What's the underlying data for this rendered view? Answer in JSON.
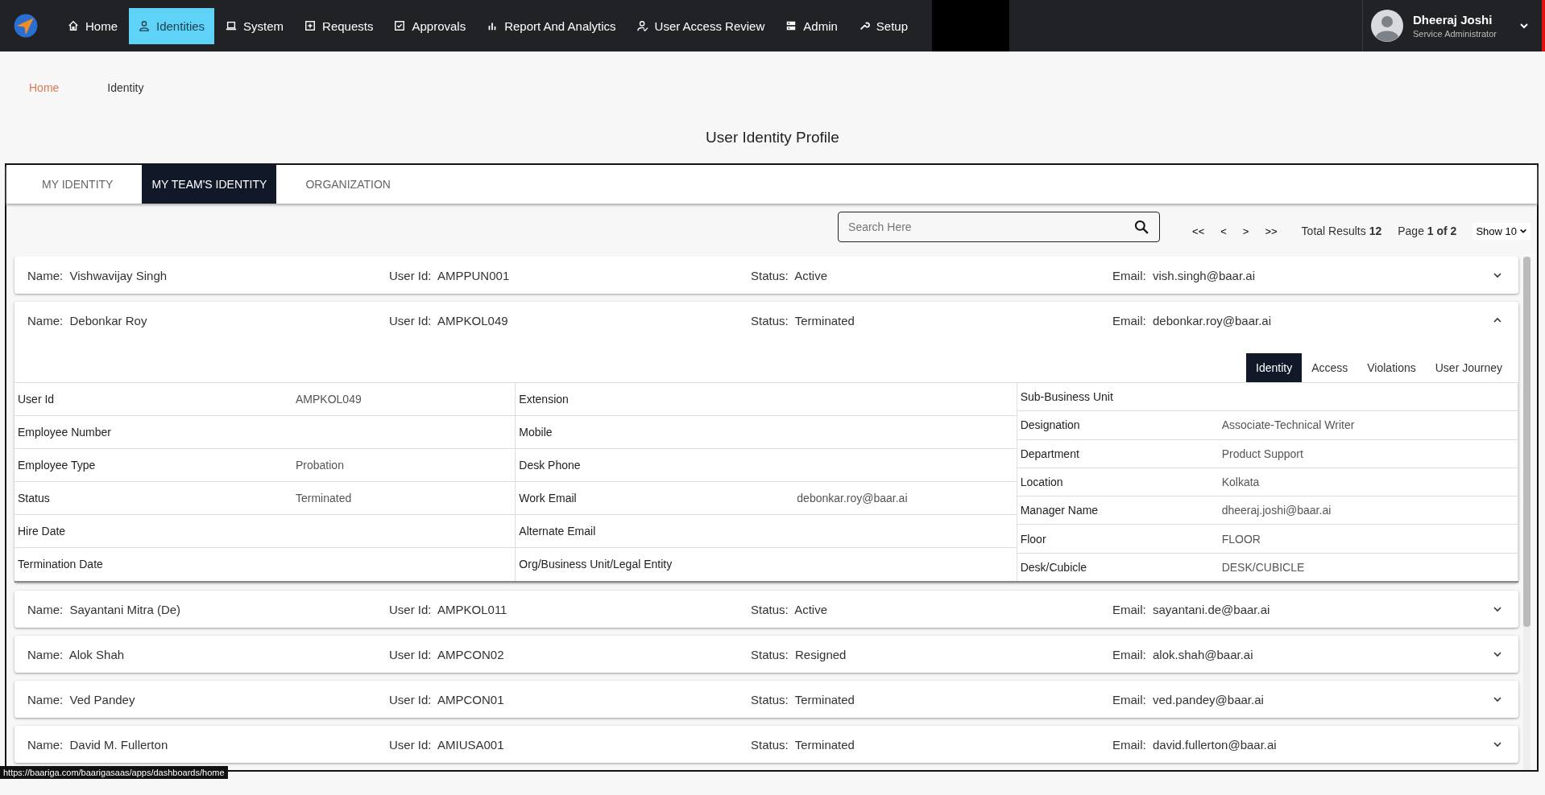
{
  "nav": {
    "items": [
      {
        "label": "Home",
        "kind": "home",
        "selected": false
      },
      {
        "label": "Identities",
        "kind": "person",
        "selected": true
      },
      {
        "label": "System",
        "kind": "laptop",
        "selected": false
      },
      {
        "label": "Requests",
        "kind": "plus-square",
        "selected": false
      },
      {
        "label": "Approvals",
        "kind": "check-square",
        "selected": false
      },
      {
        "label": "Report And Analytics",
        "kind": "bar-chart",
        "selected": false
      },
      {
        "label": "User Access Review",
        "kind": "user-check",
        "selected": false
      },
      {
        "label": "Admin",
        "kind": "server",
        "selected": false
      },
      {
        "label": "Setup",
        "kind": "wrench",
        "selected": false
      }
    ],
    "user": {
      "name": "Dheeraj Joshi",
      "role": "Service Administrator"
    }
  },
  "breadcrumb": [
    {
      "label": "Home",
      "kind": "link"
    },
    {
      "label": "Identity",
      "kind": "current"
    }
  ],
  "page_title": "User Identity Profile",
  "tabs": [
    {
      "label": "MY IDENTITY",
      "selected": false
    },
    {
      "label": "MY TEAM'S IDENTITY",
      "selected": true
    },
    {
      "label": "ORGANIZATION",
      "selected": false
    }
  ],
  "search": {
    "placeholder": "Search Here"
  },
  "pagination": {
    "first": "<<",
    "prev": "<",
    "next": ">",
    "last": ">>",
    "total_label": "Total Results",
    "total": "12",
    "page_label": "Page",
    "page": "1 of 2",
    "show": "Show 10"
  },
  "identities": [
    {
      "name_label": "Name:",
      "name": "Vishwavijay Singh",
      "user_id_label": "User Id:",
      "user_id": "AMPPUN001",
      "status_label": "Status:",
      "status": "Active",
      "email_label": "Email:",
      "email": "vish.singh@baar.ai",
      "expanded": false
    },
    {
      "name_label": "Name:",
      "name": "Debonkar Roy",
      "user_id_label": "User Id:",
      "user_id": "AMPKOL049",
      "status_label": "Status:",
      "status": "Terminated",
      "email_label": "Email:",
      "email": "debonkar.roy@baar.ai",
      "expanded": true,
      "detail": {
        "tabs": [
          {
            "label": "Identity",
            "selected": true
          },
          {
            "label": "Access",
            "selected": false
          },
          {
            "label": "Violations",
            "selected": false
          },
          {
            "label": "User Journey",
            "selected": false
          }
        ],
        "columns": [
          [
            {
              "label": "User Id",
              "value": "AMPKOL049"
            },
            {
              "label": "Employee Number"
            },
            {
              "label": "Employee Type",
              "value": "Probation"
            },
            {
              "label": "Status",
              "value": "Terminated"
            },
            {
              "label": "Hire Date"
            },
            {
              "label": "Termination Date"
            }
          ],
          [
            {
              "label": "Extension"
            },
            {
              "label": "Mobile"
            },
            {
              "label": "Desk Phone"
            },
            {
              "label": "Work Email",
              "value": "debonkar.roy@baar.ai"
            },
            {
              "label": "Alternate Email"
            },
            {
              "label": "Org/Business Unit/Legal Entity"
            }
          ],
          [
            {
              "label": "Sub-Business Unit"
            },
            {
              "label": "Designation",
              "value": "Associate-Technical Writer"
            },
            {
              "label": "Department",
              "value": "Product Support"
            },
            {
              "label": "Location",
              "value": "Kolkata"
            },
            {
              "label": "Manager Name",
              "value": "dheeraj.joshi@baar.ai"
            },
            {
              "label": "Floor",
              "value": "FLOOR"
            },
            {
              "label": "Desk/Cubicle",
              "value": "DESK/CUBICLE"
            }
          ]
        ]
      }
    },
    {
      "name_label": "Name:",
      "name": "Sayantani Mitra (De)",
      "user_id_label": "User Id:",
      "user_id": "AMPKOL011",
      "status_label": "Status:",
      "status": "Active",
      "email_label": "Email:",
      "email": "sayantani.de@baar.ai",
      "expanded": false
    },
    {
      "name_label": "Name:",
      "name": "Alok Shah",
      "user_id_label": "User Id:",
      "user_id": "AMPCON02",
      "status_label": "Status:",
      "status": "Resigned",
      "email_label": "Email:",
      "email": "alok.shah@baar.ai",
      "expanded": false
    },
    {
      "name_label": "Name:",
      "name": "Ved Pandey",
      "user_id_label": "User Id:",
      "user_id": "AMPCON01",
      "status_label": "Status:",
      "status": "Terminated",
      "email_label": "Email:",
      "email": "ved.pandey@baar.ai",
      "expanded": false
    },
    {
      "name_label": "Name:",
      "name": "David M. Fullerton",
      "user_id_label": "User Id:",
      "user_id": "AMIUSA001",
      "status_label": "Status:",
      "status": "Terminated",
      "email_label": "Email:",
      "email": "david.fullerton@baar.ai",
      "expanded": false
    }
  ],
  "status_link": "https://baariga.com/baarigasaas/apps/dashboards/home"
}
